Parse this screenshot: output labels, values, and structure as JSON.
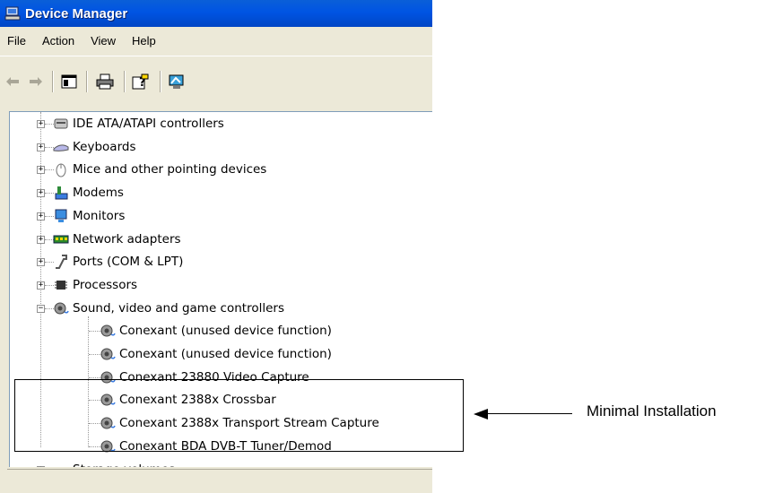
{
  "window": {
    "title": "Device Manager"
  },
  "menu": [
    "File",
    "Action",
    "View",
    "Help"
  ],
  "tree": {
    "categories": [
      {
        "label": "IDE ATA/ATAPI controllers",
        "icon": "ide-controller-icon"
      },
      {
        "label": "Keyboards",
        "icon": "keyboard-icon"
      },
      {
        "label": "Mice and other pointing devices",
        "icon": "mouse-icon"
      },
      {
        "label": "Modems",
        "icon": "modem-icon"
      },
      {
        "label": "Monitors",
        "icon": "monitor-icon"
      },
      {
        "label": "Network adapters",
        "icon": "network-adapter-icon"
      },
      {
        "label": "Ports (COM & LPT)",
        "icon": "port-icon"
      },
      {
        "label": "Processors",
        "icon": "processor-icon"
      },
      {
        "label": "Sound, video and game controllers",
        "icon": "sound-icon"
      }
    ],
    "sound_children": [
      "Conexant (unused device function)",
      "Conexant (unused device function)",
      "Conexant 23880 Video Capture",
      "Conexant 2388x Crossbar",
      "Conexant 2388x Transport Stream Capture",
      "Conexant BDA DVB-T Tuner/Demod"
    ],
    "last_category": {
      "label": "Storage volumes",
      "icon": "storage-volume-icon"
    }
  },
  "annotation": {
    "text": "Minimal Installation"
  },
  "colors": {
    "titlebar": "#0054e3",
    "chrome": "#ece9d8"
  }
}
